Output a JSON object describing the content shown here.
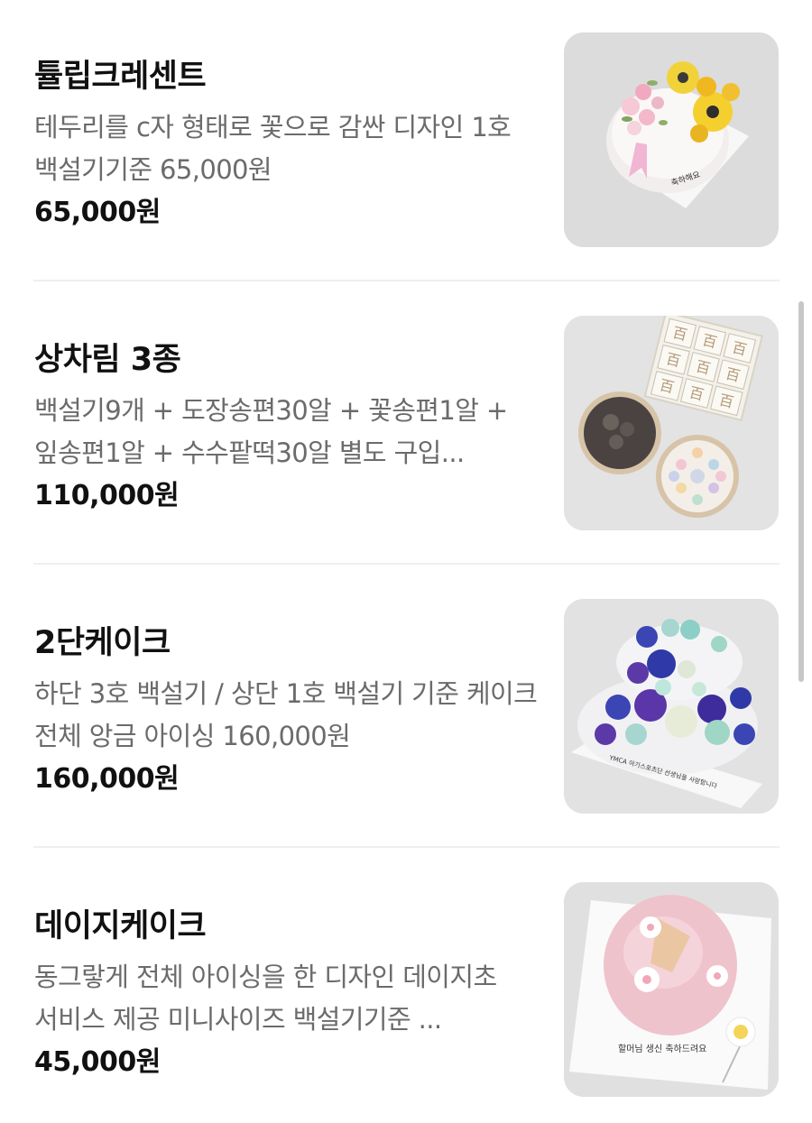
{
  "menu_items": [
    {
      "name": "튤립크레센트",
      "description": "테두리를 c자 형태로 꽃으로 감싼 디자인 1호 백설기기준 65,000원",
      "price": "65,000원",
      "image_alt": "tulip-crescent-cake-photo",
      "image_text": "축하해요"
    },
    {
      "name": "상차림 3종",
      "description": "백설기9개 + 도장송편30알 + 꽃송편1알 + 잎송편1알 + 수수팥떡30알 별도 구입...",
      "price": "110,000원",
      "image_alt": "rice-cake-set-photo",
      "image_text": "百"
    },
    {
      "name": "2단케이크",
      "description": "하단 3호 백설기 / 상단 1호 백설기 기준 케이크 전체 앙금 아이싱 160,000원",
      "price": "160,000원",
      "image_alt": "two-tier-flower-cake-photo",
      "image_text": "YMCA 아기스포츠단 선생님들 사랑합니다"
    },
    {
      "name": "데이지케이크",
      "description": "동그랗게 전체 아이싱을 한 디자인 데이지초 서비스 제공 미니사이즈 백설기기준 ...",
      "price": "45,000원",
      "image_alt": "daisy-cake-photo",
      "image_text": "할머님 생신 축하드려요"
    }
  ],
  "colors": {
    "title": "#111111",
    "description": "#6b6b6b",
    "price": "#111111",
    "divider": "#efefef",
    "thumb_background": "#e6e6e6",
    "scrollbar": "#c7c7c7"
  }
}
